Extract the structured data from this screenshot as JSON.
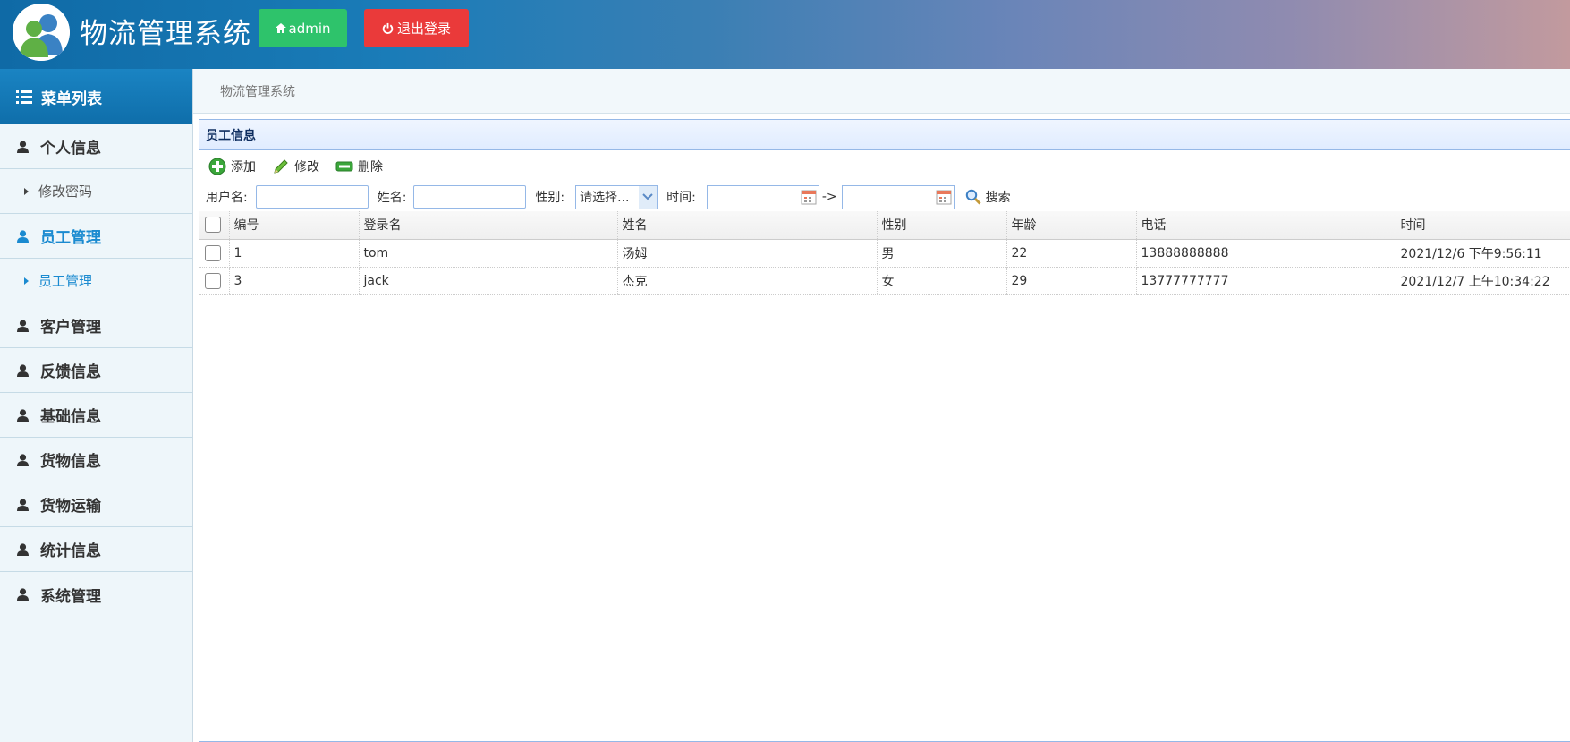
{
  "header": {
    "title": "物流管理系统",
    "admin_label": "admin",
    "logout_label": "退出登录"
  },
  "sidebar": {
    "title": "菜单列表",
    "items": [
      {
        "label": "个人信息",
        "type": "menu"
      },
      {
        "label": "修改密码",
        "type": "sub"
      },
      {
        "label": "员工管理",
        "type": "menu",
        "active": true
      },
      {
        "label": "员工管理",
        "type": "sub",
        "active": true
      },
      {
        "label": "客户管理",
        "type": "menu"
      },
      {
        "label": "反馈信息",
        "type": "menu"
      },
      {
        "label": "基础信息",
        "type": "menu"
      },
      {
        "label": "货物信息",
        "type": "menu"
      },
      {
        "label": "货物运输",
        "type": "menu"
      },
      {
        "label": "统计信息",
        "type": "menu"
      },
      {
        "label": "系统管理",
        "type": "menu"
      }
    ]
  },
  "breadcrumb": "物流管理系统",
  "panel": {
    "title": "员工信息",
    "toolbar": {
      "add": "添加",
      "edit": "修改",
      "delete": "删除"
    },
    "search": {
      "username_label": "用户名:",
      "name_label": "姓名:",
      "gender_label": "性别:",
      "gender_selected": "请选择...",
      "time_label": "时间:",
      "range_sep": "->",
      "search_label": "搜索"
    },
    "columns": [
      "编号",
      "登录名",
      "姓名",
      "性别",
      "年龄",
      "电话",
      "时间"
    ],
    "rows": [
      [
        "1",
        "tom",
        "汤姆",
        "男",
        "22",
        "13888888888",
        "2021/12/6 下午9:56:11"
      ],
      [
        "3",
        "jack",
        "杰克",
        "女",
        "29",
        "13777777777",
        "2021/12/7 上午10:34:22"
      ]
    ]
  },
  "colors": {
    "admin_button": "#2ec36b",
    "logout_button": "#ea3a3a",
    "active_menu": "#1a8ad0"
  }
}
